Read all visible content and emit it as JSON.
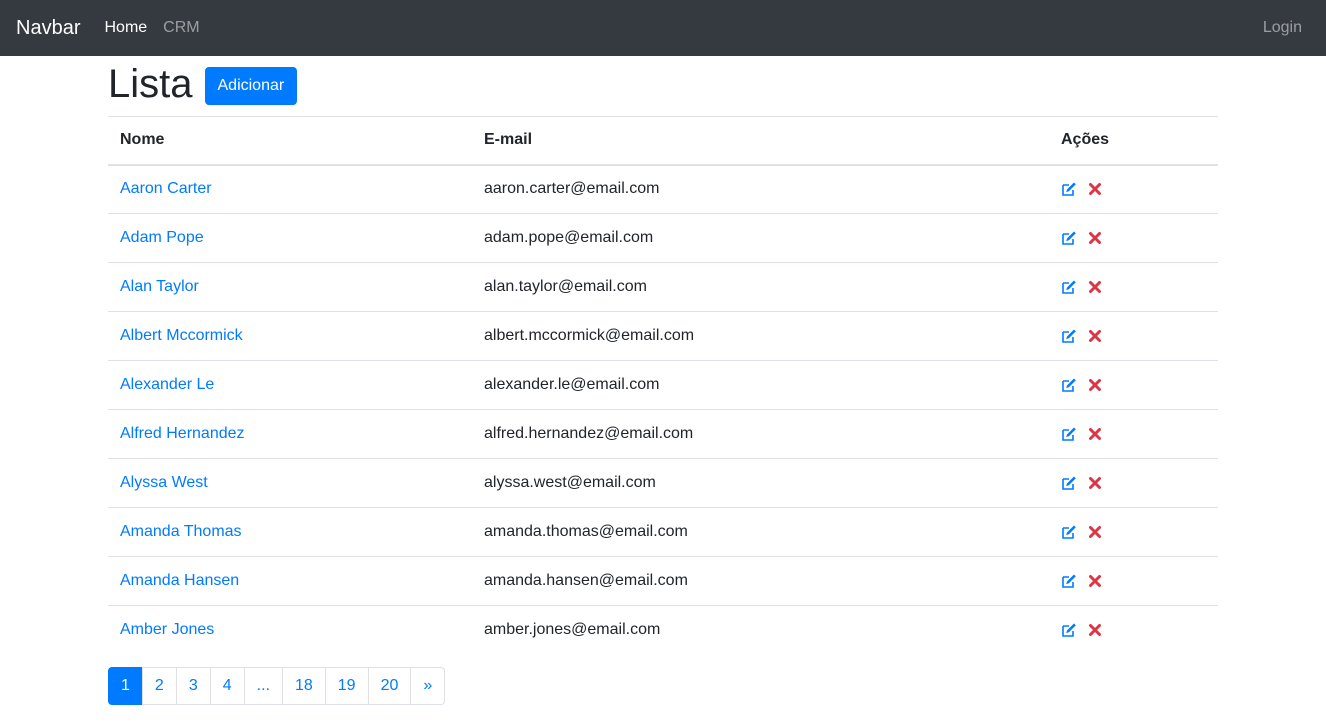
{
  "navbar": {
    "brand": "Navbar",
    "links": [
      {
        "label": "Home",
        "active": true
      },
      {
        "label": "CRM",
        "active": false
      }
    ],
    "login_label": "Login"
  },
  "header": {
    "title": "Lista",
    "add_button_label": "Adicionar"
  },
  "table": {
    "columns": [
      "Nome",
      "E-mail",
      "Ações"
    ],
    "rows": [
      {
        "name": "Aaron Carter",
        "email": "aaron.carter@email.com"
      },
      {
        "name": "Adam Pope",
        "email": "adam.pope@email.com"
      },
      {
        "name": "Alan Taylor",
        "email": "alan.taylor@email.com"
      },
      {
        "name": "Albert Mccormick",
        "email": "albert.mccormick@email.com"
      },
      {
        "name": "Alexander Le",
        "email": "alexander.le@email.com"
      },
      {
        "name": "Alfred Hernandez",
        "email": "alfred.hernandez@email.com"
      },
      {
        "name": "Alyssa West",
        "email": "alyssa.west@email.com"
      },
      {
        "name": "Amanda Thomas",
        "email": "amanda.thomas@email.com"
      },
      {
        "name": "Amanda Hansen",
        "email": "amanda.hansen@email.com"
      },
      {
        "name": "Amber Jones",
        "email": "amber.jones@email.com"
      }
    ],
    "actions": [
      {
        "icon": "edit-icon",
        "color": "#007bff"
      },
      {
        "icon": "delete-icon",
        "color": "#dc3545"
      }
    ]
  },
  "pagination": {
    "pages": [
      "1",
      "2",
      "3",
      "4",
      "...",
      "18",
      "19",
      "20",
      "»"
    ],
    "active_page": "1"
  },
  "colors": {
    "navbar_bg": "#343a40",
    "primary": "#007bff",
    "danger": "#dc3545",
    "border": "#dee2e6"
  }
}
